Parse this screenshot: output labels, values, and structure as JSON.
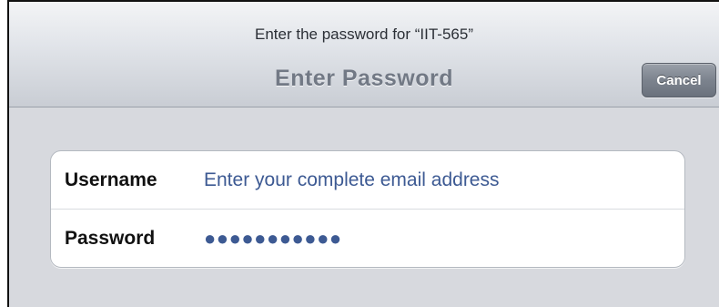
{
  "header": {
    "prompt": "Enter the password for “IIT-565”",
    "title": "Enter Password",
    "cancel_label": "Cancel"
  },
  "form": {
    "username": {
      "label": "Username",
      "placeholder": "Enter your complete email address"
    },
    "password": {
      "label": "Password",
      "masked_value": "●●●●●●●●●●●"
    }
  },
  "colors": {
    "value_text": "#3d5a93",
    "cancel_button": "#7c838e",
    "background": "#d7d9de"
  }
}
